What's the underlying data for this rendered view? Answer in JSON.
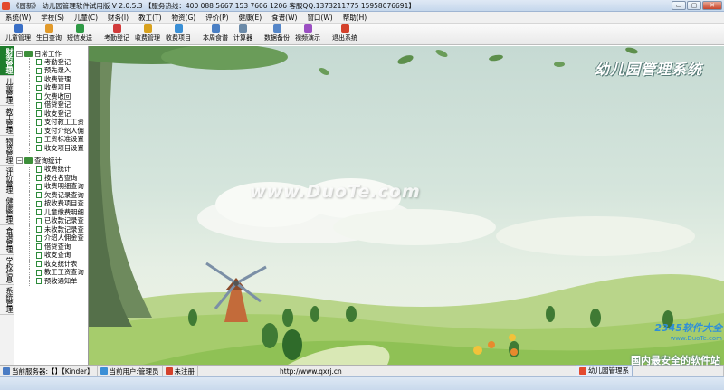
{
  "window": {
    "title": "《厨新》 幼儿园管理软件试用版 V 2.0.5.3 【服务热线：400 088 5667  153 7606 1206  客服QQ:1373211775  15958076691】",
    "buttons": [
      "▭",
      "▢",
      "✕"
    ]
  },
  "menu": [
    "系统(W)",
    "学校(S)",
    "儿童(C)",
    "财务(I)",
    "教工(T)",
    "物资(G)",
    "评价(P)",
    "健康(E)",
    "食谱(W)",
    "窗口(W)",
    "帮助(H)"
  ],
  "toolbar": {
    "groups": [
      [
        {
          "label": "儿童管理",
          "icon": "child-icon",
          "color": "#3a6fc6"
        },
        {
          "label": "生日查询",
          "icon": "birthday-icon",
          "color": "#e29a2a"
        },
        {
          "label": "短信发送",
          "icon": "sms-icon",
          "color": "#2e9a45"
        }
      ],
      [
        {
          "label": "考勤登记",
          "icon": "attendance-icon",
          "color": "#d23b3b"
        },
        {
          "label": "收费管理",
          "icon": "fee-icon",
          "color": "#d9a21e"
        },
        {
          "label": "收费项目",
          "icon": "fee-item-icon",
          "color": "#3a8fd6"
        }
      ],
      [
        {
          "label": "本周食谱",
          "icon": "menu-icon",
          "color": "#4a7fc4"
        },
        {
          "label": "计算器",
          "icon": "calculator-icon",
          "color": "#6b8aa8"
        }
      ],
      [
        {
          "label": "数据备份",
          "icon": "backup-icon",
          "color": "#5586c8"
        },
        {
          "label": "视频演示",
          "icon": "video-icon",
          "color": "#9b4fc2"
        }
      ],
      [
        {
          "label": "退出系统",
          "icon": "exit-icon",
          "color": "#d4412b"
        }
      ]
    ]
  },
  "vtabs": [
    {
      "label": "财务管理",
      "active": true
    },
    {
      "label": "儿童管理",
      "active": false
    },
    {
      "label": "教工管理",
      "active": false
    },
    {
      "label": "物资管理",
      "active": false
    },
    {
      "label": "评价管理",
      "active": false
    },
    {
      "label": "健康管理",
      "active": false
    },
    {
      "label": "食谱管理",
      "active": false
    },
    {
      "label": "学校信息",
      "active": false
    },
    {
      "label": "系统管理",
      "active": false
    }
  ],
  "tree": [
    {
      "label": "日常工作",
      "items": [
        "考勤登记",
        "预先录入",
        "收费管理",
        "收费项目",
        "欠费收回",
        "借贷登记",
        "收支登记",
        "支付教工工资",
        "支付介绍人佣",
        "工资标准设置",
        "收支项目设置"
      ]
    },
    {
      "label": "查询统计",
      "items": [
        "收费统计",
        "按姓名查询",
        "收费明细查询",
        "欠费记录查询",
        "按收费项目查",
        "儿童缴费明细",
        "已收款记录查",
        "未收款记录查",
        "介绍人佣金查",
        "借贷查询",
        "收支查询",
        "收支统计表",
        "教工工资查询",
        "预收通知单"
      ]
    }
  ],
  "main": {
    "banner": "幼儿园管理系统",
    "watermark": "www.DuoTe.com",
    "logo_line1": "2345软件大全",
    "logo_line2": "www.DuoTe.com",
    "promo": "国内最安全的软件站"
  },
  "statusbar": {
    "server": "当前服务器:【】【Kinder】",
    "user": "当前用户:管理员",
    "reg": "未注册",
    "url": "http://www.qxrj.cn",
    "app": "幼儿园管理系"
  },
  "colors": {
    "active_tab": "#1e7d2c",
    "folder": "#3d8f3a"
  }
}
